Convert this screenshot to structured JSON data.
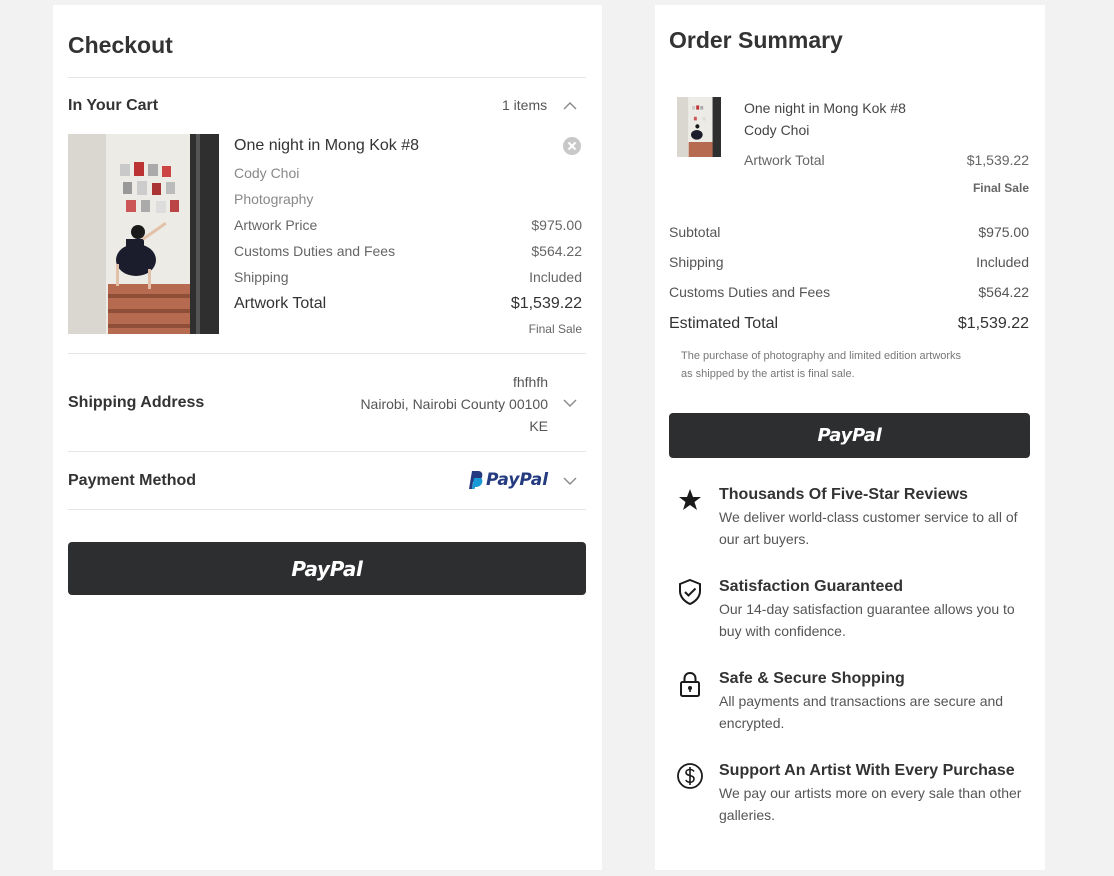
{
  "checkout": {
    "title": "Checkout",
    "cart": {
      "label": "In Your Cart",
      "count": "1 items",
      "item": {
        "title": "One night in Mong Kok #8",
        "artist": "Cody Choi",
        "medium": "Photography",
        "rows": [
          {
            "label": "Artwork Price",
            "value": "$975.00"
          },
          {
            "label": "Customs Duties and Fees",
            "value": "$564.22"
          },
          {
            "label": "Shipping",
            "value": "Included"
          }
        ],
        "total_label": "Artwork Total",
        "total_value": "$1,539.22",
        "final_sale": "Final Sale"
      }
    },
    "shipping": {
      "label": "Shipping Address",
      "line1": "fhfhfh",
      "line2": "Nairobi, Nairobi County 00100",
      "line3": "KE"
    },
    "payment": {
      "label": "Payment Method",
      "method": "PayPal"
    },
    "pay_button": "PayPal"
  },
  "summary": {
    "title": "Order Summary",
    "item": {
      "title": "One night in Mong Kok #8",
      "artist": "Cody Choi",
      "total_label": "Artwork Total",
      "total_value": "$1,539.22",
      "final_sale": "Final Sale"
    },
    "rows": [
      {
        "label": "Subtotal",
        "value": "$975.00"
      },
      {
        "label": "Shipping",
        "value": "Included"
      },
      {
        "label": "Customs Duties and Fees",
        "value": "$564.22"
      }
    ],
    "estimated_label": "Estimated Total",
    "estimated_value": "$1,539.22",
    "note_line1": "The purchase of photography and limited edition artworks",
    "note_line2": "as shipped by the artist is final sale.",
    "pay_button": "PayPal"
  },
  "benefits": [
    {
      "icon": "star-icon",
      "title": "Thousands Of Five-Star Reviews",
      "text": "We deliver world-class customer service to all of our art buyers."
    },
    {
      "icon": "shield-check-icon",
      "title": "Satisfaction Guaranteed",
      "text": "Our 14-day satisfaction guarantee allows you to buy with confidence."
    },
    {
      "icon": "lock-icon",
      "title": "Safe & Secure Shopping",
      "text": "All payments and transactions are secure and encrypted."
    },
    {
      "icon": "dollar-coin-icon",
      "title": "Support An Artist With Every Purchase",
      "text": "We pay our artists more on every sale than other galleries."
    }
  ],
  "colors": {
    "background": "#f2f2f2",
    "panel": "#ffffff",
    "text": "#333333",
    "muted": "#888888",
    "button": "#2c2e2f",
    "paypal_dark": "#253b80",
    "paypal_light": "#179bd7"
  }
}
